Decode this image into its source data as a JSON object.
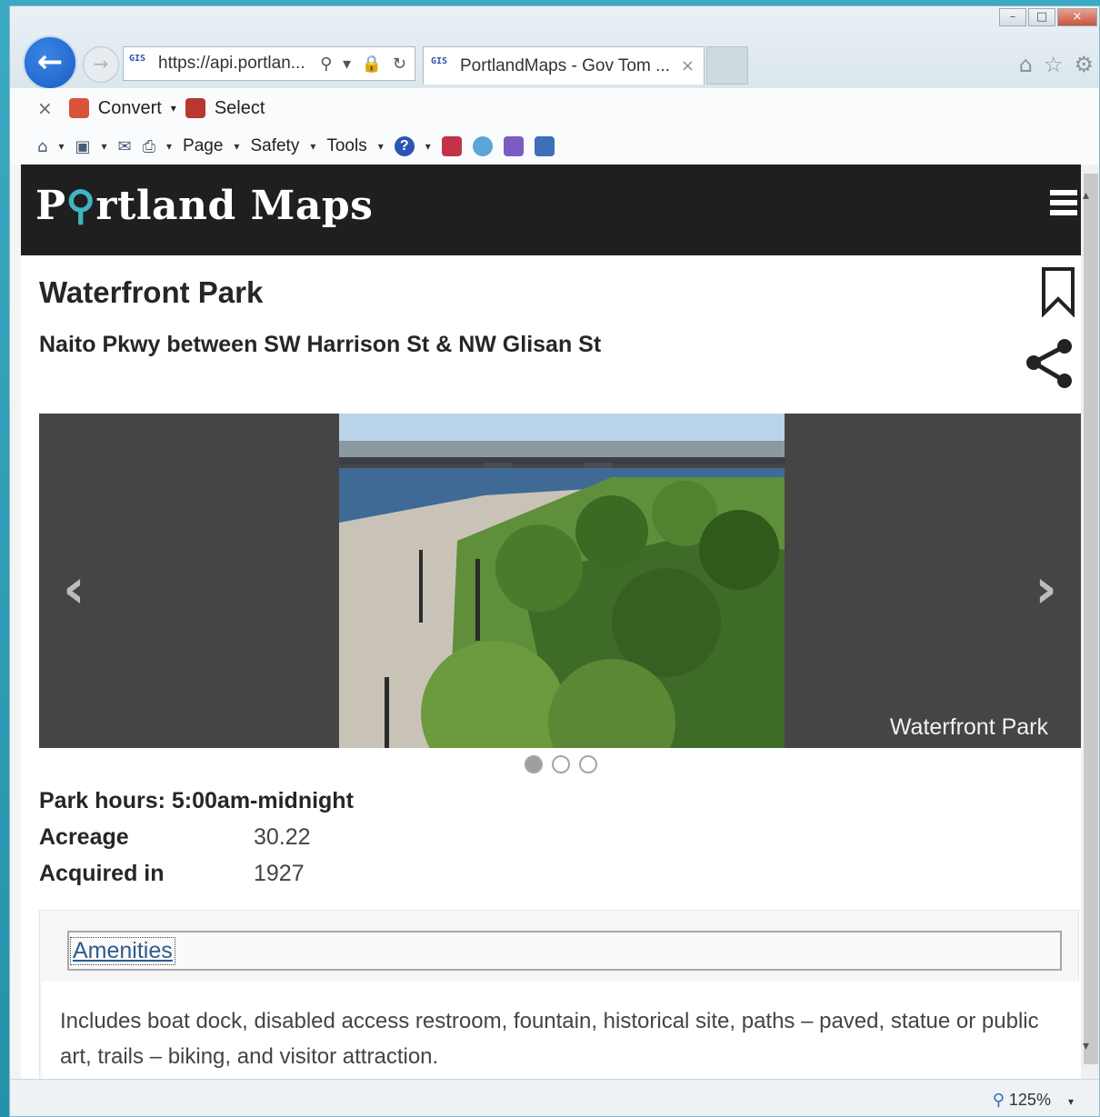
{
  "browser": {
    "url": "https://api.portlan...",
    "tab_title": "PortlandMaps - Gov Tom ...",
    "favicon_text": "GIS",
    "back_symbol": "←",
    "forward_symbol": "→",
    "address_icons": "⚲ ▾ 🔒 ↻",
    "tab_close": "×",
    "right_icons": [
      "⌂",
      "☆",
      "⚙"
    ],
    "window_controls": [
      "–",
      "□",
      "×"
    ]
  },
  "command_bar": {
    "close": "×",
    "convert": "Convert",
    "select": "Select",
    "page": "Page",
    "safety": "Safety",
    "tools": "Tools",
    "caret": "▾",
    "help": "?"
  },
  "site": {
    "logo_before": "P",
    "logo_pin": "⚲",
    "logo_after": "rtland Maps"
  },
  "park": {
    "title": "Waterfront Park",
    "address": "Naito Pkwy between SW Harrison St & NW Glisan St",
    "photo_caption": "Waterfront Park",
    "prev": "‹",
    "next": "›",
    "slide_count": 3,
    "active_slide": 1
  },
  "details": {
    "hours": "Park hours: 5:00am-midnight",
    "acreage_label": "Acreage",
    "acreage_value": "30.22",
    "acquired_label": "Acquired in",
    "acquired_value": "1927"
  },
  "amenities": {
    "heading": "Amenities",
    "text": "Includes boat dock, disabled access restroom, fountain, historical site, paths – paved, statue or public art, trails – biking, and visitor attraction."
  },
  "status": {
    "zoom": "125%",
    "zoom_caret": "▾"
  }
}
